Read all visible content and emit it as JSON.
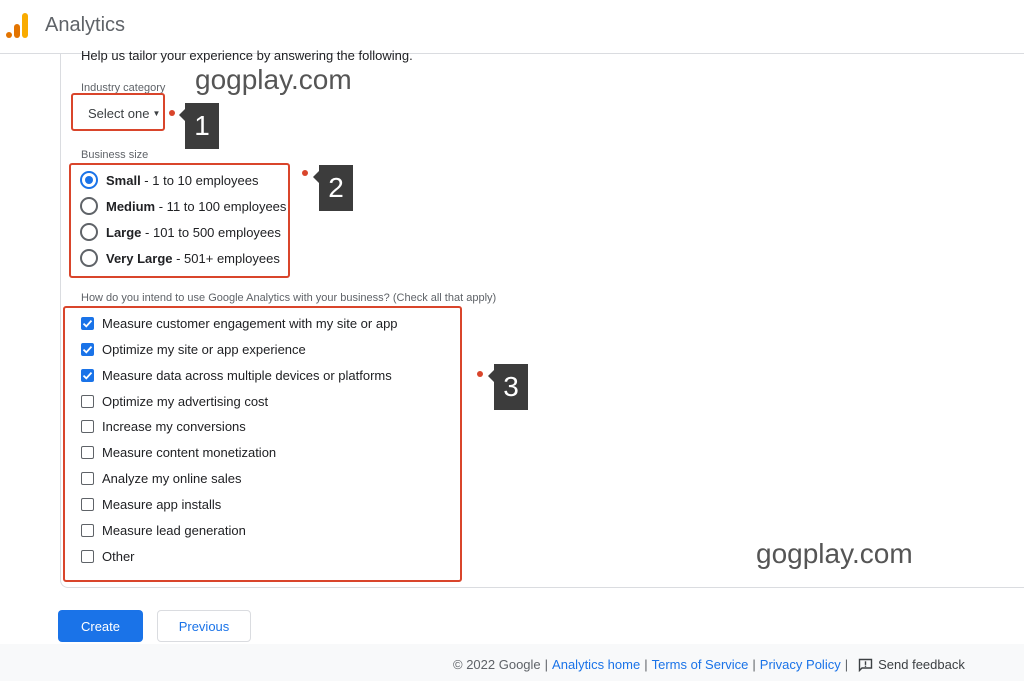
{
  "header": {
    "title": "Analytics",
    "logo_icon": "analytics-bars-icon"
  },
  "intro": "Help us tailor your experience by answering the following.",
  "industry": {
    "label": "Industry category",
    "selected": "Select one"
  },
  "business_size": {
    "label": "Business size",
    "options": [
      {
        "bold": "Small",
        "detail": " - 1 to 10 employees",
        "checked": true
      },
      {
        "bold": "Medium",
        "detail": " - 11 to 100 employees",
        "checked": false
      },
      {
        "bold": "Large",
        "detail": " - 101 to 500 employees",
        "checked": false
      },
      {
        "bold": "Very Large",
        "detail": " - 501+ employees",
        "checked": false
      }
    ]
  },
  "usage": {
    "label": "How do you intend to use Google Analytics with your business? (Check all that apply)",
    "options": [
      {
        "label": "Measure customer engagement with my site or app",
        "checked": true
      },
      {
        "label": "Optimize my site or app experience",
        "checked": true
      },
      {
        "label": "Measure data across multiple devices or platforms",
        "checked": true
      },
      {
        "label": "Optimize my advertising cost",
        "checked": false
      },
      {
        "label": "Increase my conversions",
        "checked": false
      },
      {
        "label": "Measure content monetization",
        "checked": false
      },
      {
        "label": "Analyze my online sales",
        "checked": false
      },
      {
        "label": "Measure app installs",
        "checked": false
      },
      {
        "label": "Measure lead generation",
        "checked": false
      },
      {
        "label": "Other",
        "checked": false
      }
    ]
  },
  "annotations": {
    "marker1": "1",
    "marker2": "2",
    "marker3": "3"
  },
  "watermarks": {
    "top": "gogplay.com",
    "bottom": "gogplay.com"
  },
  "buttons": {
    "create": "Create",
    "previous": "Previous"
  },
  "footer": {
    "copyright": "© 2022 Google",
    "analytics_home": "Analytics home",
    "terms": "Terms of Service",
    "privacy": "Privacy Policy",
    "feedback": "Send feedback"
  },
  "colors": {
    "accent": "#1a73e8",
    "annotation": "#d9452b",
    "marker_bg": "#3c3c3c"
  }
}
